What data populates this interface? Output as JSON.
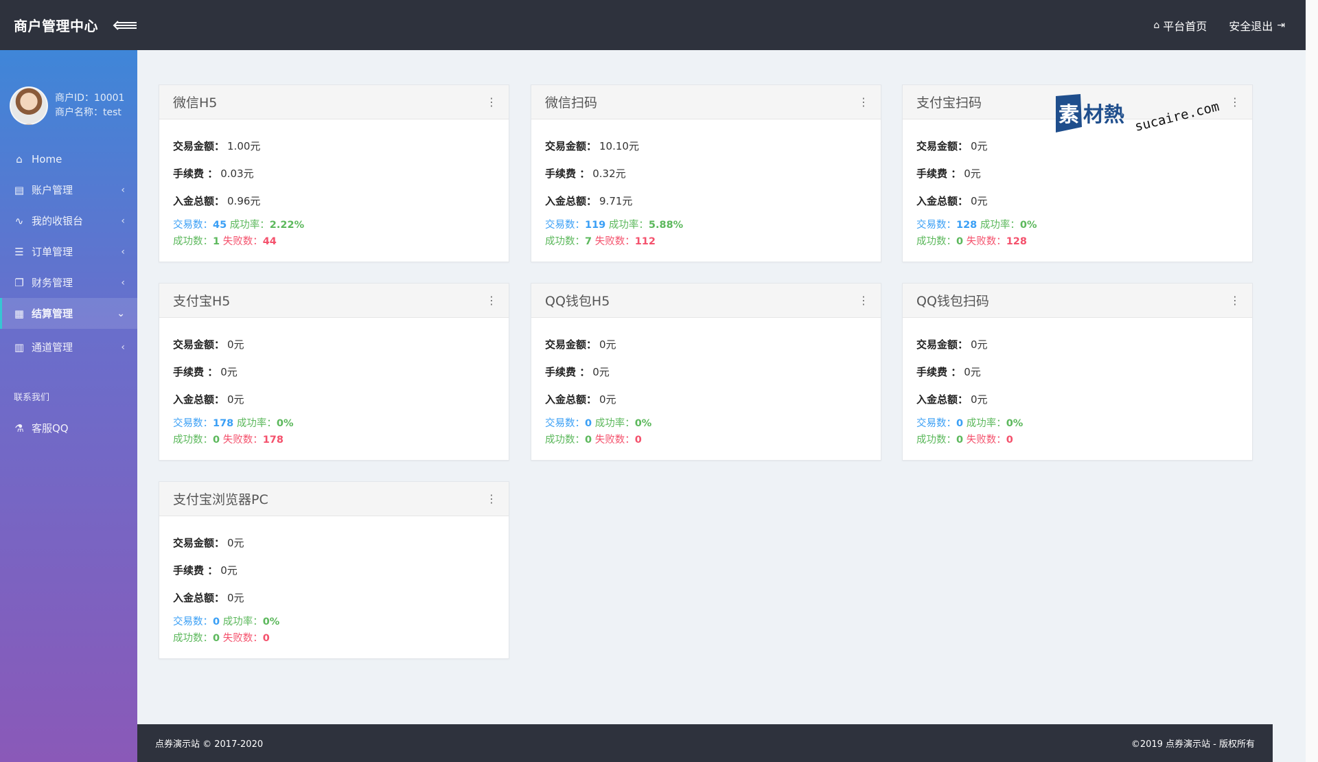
{
  "topbar": {
    "brand": "商户管理中心",
    "home_label": "平台首页",
    "logout_label": "安全退出"
  },
  "user": {
    "id_line": "商户ID：10001",
    "name_line": "商户名称：test"
  },
  "sidebar": {
    "items": [
      {
        "label": "Home",
        "icon": "home-icon"
      },
      {
        "label": "账户管理",
        "icon": "clipboard-icon"
      },
      {
        "label": "我的收银台",
        "icon": "line-chart-icon"
      },
      {
        "label": "订单管理",
        "icon": "list-icon"
      },
      {
        "label": "财务管理",
        "icon": "copy-icon"
      },
      {
        "label": "结算管理",
        "icon": "server-icon"
      },
      {
        "label": "通道管理",
        "icon": "stack-icon"
      }
    ],
    "section_title": "联系我们",
    "contact_item": {
      "label": "客服QQ",
      "icon": "flask-icon"
    }
  },
  "labels": {
    "amount": "交易金额：",
    "fee": "手续费 ：",
    "total": "入金总额：",
    "count": "交易数：",
    "rate": "成功率：",
    "success": "成功数：",
    "fail": "失败数："
  },
  "channels": [
    {
      "title": "微信H5",
      "amount": "1.00元",
      "fee": "0.03元",
      "total": "0.96元",
      "count": "45",
      "rate": "2.22%",
      "success": "1",
      "fail": "44"
    },
    {
      "title": "微信扫码",
      "amount": "10.10元",
      "fee": "0.32元",
      "total": "9.71元",
      "count": "119",
      "rate": "5.88%",
      "success": "7",
      "fail": "112"
    },
    {
      "title": "支付宝扫码",
      "amount": "0元",
      "fee": "0元",
      "total": "0元",
      "count": "128",
      "rate": "0%",
      "success": "0",
      "fail": "128"
    },
    {
      "title": "支付宝H5",
      "amount": "0元",
      "fee": "0元",
      "total": "0元",
      "count": "178",
      "rate": "0%",
      "success": "0",
      "fail": "178"
    },
    {
      "title": "QQ钱包H5",
      "amount": "0元",
      "fee": "0元",
      "total": "0元",
      "count": "0",
      "rate": "0%",
      "success": "0",
      "fail": "0"
    },
    {
      "title": "QQ钱包扫码",
      "amount": "0元",
      "fee": "0元",
      "total": "0元",
      "count": "0",
      "rate": "0%",
      "success": "0",
      "fail": "0"
    },
    {
      "title": "支付宝浏览器PC",
      "amount": "0元",
      "fee": "0元",
      "total": "0元",
      "count": "0",
      "rate": "0%",
      "success": "0",
      "fail": "0"
    }
  ],
  "watermark": {
    "cn": "素材熱",
    "en": "sucaire.com"
  },
  "footer": {
    "left": "点券演示站 © 2017-2020",
    "right": "©2019 点券演示站 - 版权所有"
  },
  "colors": {
    "topbar": "#2e323d",
    "sidebar_top": "#3f86d8",
    "sidebar_bottom": "#8a59b8",
    "count_blue": "#3a9ff5",
    "success_green": "#5cb85c",
    "fail_red": "#f4516c"
  }
}
